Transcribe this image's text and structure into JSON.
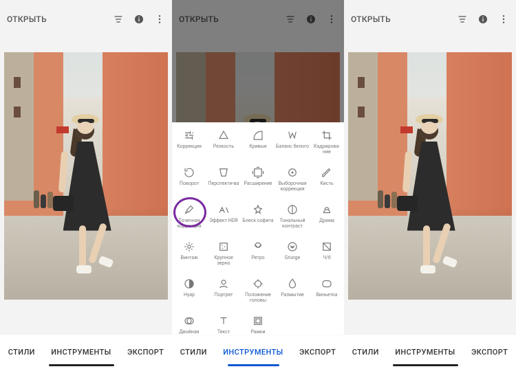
{
  "topbar": {
    "open_label": "ОТКРЫТЬ"
  },
  "tabs": {
    "styles": "СТИЛИ",
    "tools": "ИНСТРУМЕНТЫ",
    "export": "ЭКСПОРТ"
  },
  "tools_grid": [
    [
      {
        "id": "tune",
        "label": "Коррекция"
      },
      {
        "id": "details",
        "label": "Резкость"
      },
      {
        "id": "curves",
        "label": "Кривые"
      },
      {
        "id": "wb",
        "label": "Баланс белого"
      },
      {
        "id": "crop",
        "label": "Кадрирова-ние"
      }
    ],
    [
      {
        "id": "rotate",
        "label": "Поворот"
      },
      {
        "id": "perspective",
        "label": "Перспекти-ва"
      },
      {
        "id": "expand",
        "label": "Расширение"
      },
      {
        "id": "selective",
        "label": "Выборочная коррекция"
      },
      {
        "id": "brush",
        "label": "Кисть"
      }
    ],
    [
      {
        "id": "healing",
        "label": "Точечная коррекция"
      },
      {
        "id": "hdr",
        "label": "Эффект HDR"
      },
      {
        "id": "glamour",
        "label": "Блеск софита"
      },
      {
        "id": "tonal",
        "label": "Тональный контраст"
      },
      {
        "id": "drama",
        "label": "Драма"
      }
    ],
    [
      {
        "id": "vintage",
        "label": "Винтаж"
      },
      {
        "id": "grainy",
        "label": "Крупное зерно"
      },
      {
        "id": "retro",
        "label": "Ретро"
      },
      {
        "id": "grunge",
        "label": "Grunge"
      },
      {
        "id": "bw",
        "label": "Ч/б"
      }
    ],
    [
      {
        "id": "noir",
        "label": "Нуар"
      },
      {
        "id": "portrait",
        "label": "Портрет"
      },
      {
        "id": "headpose",
        "label": "Положение головы"
      },
      {
        "id": "blur",
        "label": "Размытие"
      },
      {
        "id": "vignette",
        "label": "Виньетка"
      }
    ],
    [
      {
        "id": "double",
        "label": "Двойная экспозиция"
      },
      {
        "id": "text",
        "label": "Текст"
      },
      {
        "id": "frames",
        "label": "Рамки"
      }
    ]
  ],
  "annotation": {
    "target_tool_id": "healing"
  }
}
